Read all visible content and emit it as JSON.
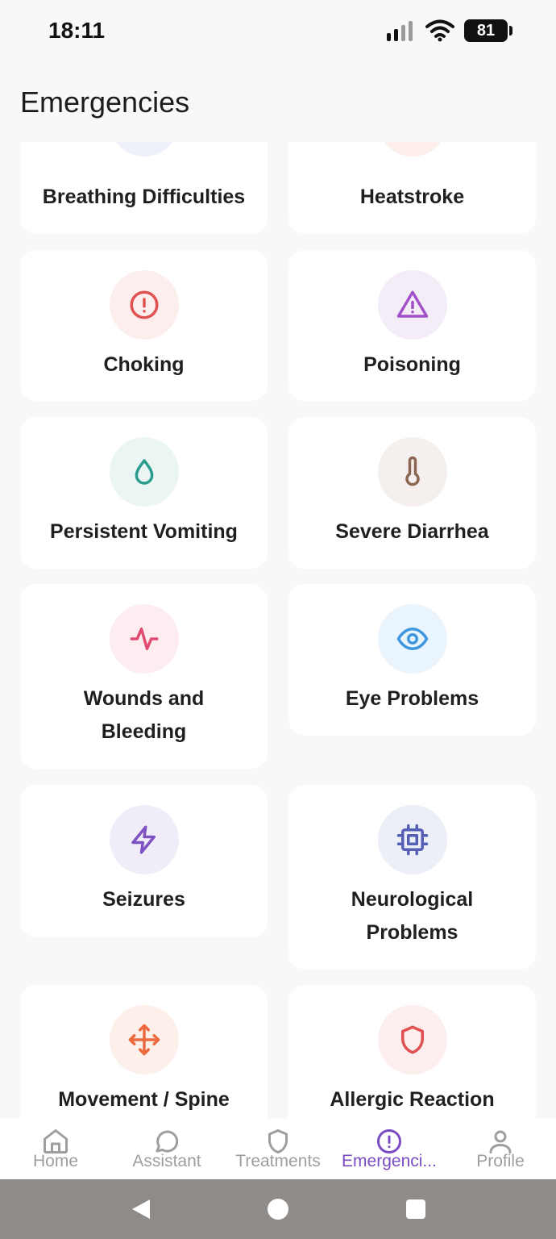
{
  "status": {
    "time": "18:11",
    "battery": "81"
  },
  "page": {
    "title": "Emergencies"
  },
  "cards": [
    {
      "label": "Breathing Difficulties",
      "icon": "wind-icon",
      "bg": "#eef0fa",
      "color": "#6470c4"
    },
    {
      "label": "Heatstroke",
      "icon": "sun-icon",
      "bg": "#fdeeea",
      "color": "#ea5a3b"
    },
    {
      "label": "Choking",
      "icon": "alert-circle-icon",
      "bg": "#fdeeee",
      "color": "#e05252"
    },
    {
      "label": "Poisoning",
      "icon": "warning-triangle-icon",
      "bg": "#f4edf8",
      "color": "#a152c9"
    },
    {
      "label": "Persistent Vomiting",
      "icon": "droplet-icon",
      "bg": "#ebf6f4",
      "color": "#2b9c8e"
    },
    {
      "label": "Severe Diarrhea",
      "icon": "thermometer-icon",
      "bg": "#f5f0ee",
      "color": "#8d6555"
    },
    {
      "label": "Wounds and Bleeding",
      "icon": "pulse-icon",
      "bg": "#fdedf1",
      "color": "#e04c72"
    },
    {
      "label": "Eye Problems",
      "icon": "eye-icon",
      "bg": "#eaf4fc",
      "color": "#3f97e0"
    },
    {
      "label": "Seizures",
      "icon": "lightning-icon",
      "bg": "#f1edf8",
      "color": "#7f52c2"
    },
    {
      "label": "Neurological Problems",
      "icon": "chip-icon",
      "bg": "#edeff8",
      "color": "#5560b4"
    },
    {
      "label": "Movement / Spine",
      "icon": "move-icon",
      "bg": "#fdefea",
      "color": "#ec6a3e"
    },
    {
      "label": "Allergic Reaction",
      "icon": "shield-icon",
      "bg": "#fdeeee",
      "color": "#e05252"
    }
  ],
  "tabs": [
    {
      "label": "Home",
      "icon": "home-icon"
    },
    {
      "label": "Assistant",
      "icon": "chat-icon"
    },
    {
      "label": "Treatments",
      "icon": "shield-icon"
    },
    {
      "label": "Emergenci...",
      "icon": "alert-circle-icon"
    },
    {
      "label": "Profile",
      "icon": "user-icon"
    }
  ],
  "colors": {
    "active_tab": "#7a4bc2",
    "inactive_tab": "#9e9e9e",
    "nav_bar": "#8f8b88"
  }
}
